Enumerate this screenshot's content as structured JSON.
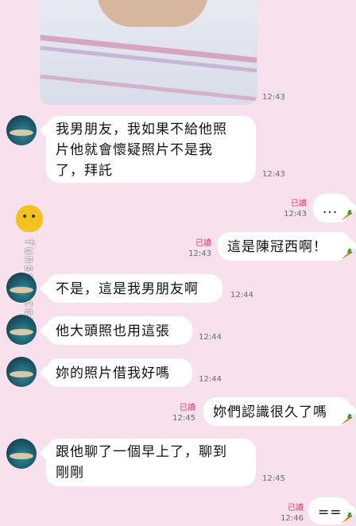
{
  "photo": {
    "time": "12:43"
  },
  "messages": [
    {
      "lines": [
        "我男朋友，我如果不給他照",
        "片他就會懷疑照片不是我",
        "了，拜託"
      ],
      "time": "12:43"
    },
    {
      "text": "...",
      "read": "已讀",
      "time": "12:43"
    },
    {
      "text": "這是陳冠西啊！",
      "read": "已讀",
      "time": "12:43"
    },
    {
      "text": "不是，這是我男朋友啊",
      "time": "12:44"
    },
    {
      "text": "他大頭照也用這張",
      "time": "12:44"
    },
    {
      "text": "妳的照片借我好嗎",
      "time": "12:44"
    },
    {
      "text": "妳們認識很久了嗎",
      "read": "已讀",
      "time": "12:45"
    },
    {
      "lines": [
        "跟他聊了一個早上了，聊到",
        "剛剛"
      ],
      "time": "12:45"
    },
    {
      "text": "==",
      "read": "已讀",
      "time": "12:46"
    }
  ],
  "watermark": {
    "text": "funssy.com"
  },
  "colors": {
    "background": "#f6e1ec",
    "bubble": "#ffffff",
    "read": "#e23a74"
  },
  "icons": {
    "avatar": "beach-avatar-icon",
    "sticker": "carrot-icon",
    "mascot": "chick-mascot-icon"
  }
}
